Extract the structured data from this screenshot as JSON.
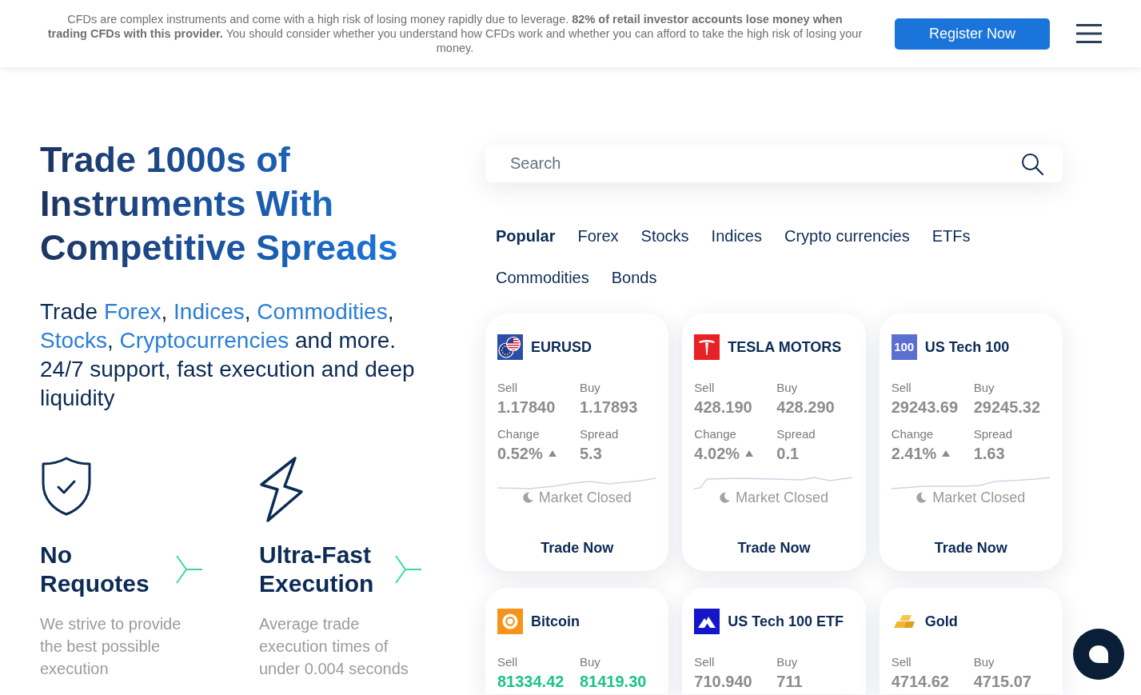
{
  "risk_banner": {
    "text": "CFDs are complex instruments and come with a high risk of losing money rapidly due to leverage. **82% of retail investor accounts lose money when trading CFDs with this provider.** You should consider whether you understand how CFDs work and whether you can afford to take the high risk of losing your money.",
    "register_button": "Register Now"
  },
  "hero": {
    "heading": "Trade 1000s of Instruments With Competitive Spreads",
    "subtitle": [
      {
        "kind": "text",
        "text": "Trade "
      },
      {
        "kind": "link",
        "text": "Forex"
      },
      {
        "kind": "text",
        "text": ", "
      },
      {
        "kind": "link",
        "text": "Indices"
      },
      {
        "kind": "text",
        "text": ", "
      },
      {
        "kind": "link",
        "text": "Commodities"
      },
      {
        "kind": "text",
        "text": ", "
      },
      {
        "kind": "link",
        "text": "Stocks"
      },
      {
        "kind": "text",
        "text": ", "
      },
      {
        "kind": "link",
        "text": "Cryptocurrencies"
      },
      {
        "kind": "text",
        "text": " and more. 24/7 support, fast execution and deep liquidity"
      }
    ]
  },
  "features": [
    {
      "kind": "shield",
      "title": "No Requotes",
      "description": "We strive to provide the best possible execution"
    },
    {
      "kind": "bolt",
      "title": "Ultra-Fast Execution",
      "description": "Average trade execution times of under 0.004 seconds"
    }
  ],
  "instruments": {
    "search": {
      "placeholder": "Search"
    },
    "tabs": [
      {
        "label": "Popular",
        "selected": true
      },
      {
        "label": "Forex",
        "selected": false
      },
      {
        "label": "Stocks",
        "selected": false
      },
      {
        "label": "Indices",
        "selected": false
      },
      {
        "label": "Crypto currencies",
        "selected": false
      },
      {
        "label": "ETFs",
        "selected": false
      },
      {
        "label": "Commodities",
        "selected": false
      },
      {
        "label": "Bonds",
        "selected": false
      }
    ],
    "cards": [
      {
        "name": "EURUSD",
        "logo": {
          "kind": "flags"
        },
        "sell_label": "Sell",
        "sell": "1.17840",
        "buy_label": "Buy",
        "buy": "1.17893",
        "change_label": "Change",
        "change": "0.52%",
        "rising": true,
        "spread_label": "Spread",
        "spread": "5.3",
        "market_status": "Market Closed",
        "action": "Trade Now",
        "price_up": false
      },
      {
        "name": "TESLA MOTORS",
        "logo": {
          "kind": "t-logo"
        },
        "sell_label": "Sell",
        "sell": "428.190",
        "buy_label": "Buy",
        "buy": "428.290",
        "change_label": "Change",
        "change": "4.02%",
        "rising": true,
        "spread_label": "Spread",
        "spread": "0.1",
        "market_status": "Market Closed",
        "action": "Trade Now",
        "price_up": false
      },
      {
        "name": "US Tech 100",
        "logo": {
          "kind": "text",
          "text": "100"
        },
        "sell_label": "Sell",
        "sell": "29243.69",
        "buy_label": "Buy",
        "buy": "29245.32",
        "change_label": "Change",
        "change": "2.41%",
        "rising": true,
        "spread_label": "Spread",
        "spread": "1.63",
        "market_status": "Market Closed",
        "action": "Trade Now",
        "price_up": false
      },
      {
        "name": "Bitcoin",
        "logo": {
          "kind": "coin"
        },
        "sell_label": "Sell",
        "sell": "81334.42",
        "buy_label": "Buy",
        "buy": "81419.30",
        "price_up": true
      },
      {
        "name": "US Tech 100 ETF",
        "logo": {
          "kind": "mountain"
        },
        "sell_label": "Sell",
        "sell": "710.940",
        "buy_label": "Buy",
        "buy": "711",
        "price_up": false
      },
      {
        "name": "Gold",
        "logo": {
          "kind": "bars"
        },
        "sell_label": "Sell",
        "sell": "4714.62",
        "buy_label": "Buy",
        "buy": "4715.07",
        "price_up": false
      }
    ]
  }
}
